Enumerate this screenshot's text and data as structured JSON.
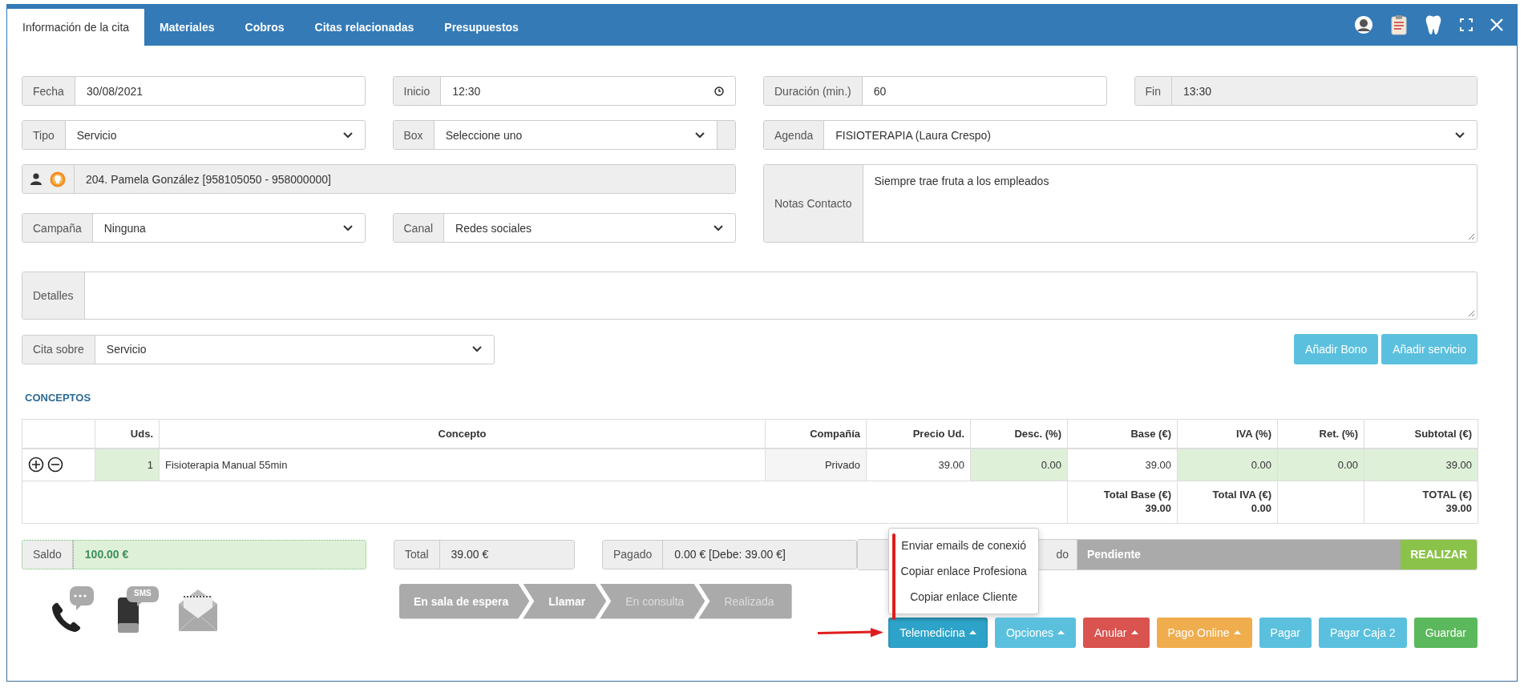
{
  "tabs": [
    {
      "label": "Información de la cita",
      "selected": true
    },
    {
      "label": "Materiales",
      "selected": false
    },
    {
      "label": "Cobros",
      "selected": false
    },
    {
      "label": "Citas relacionadas",
      "selected": false
    },
    {
      "label": "Presupuestos",
      "selected": false
    }
  ],
  "form": {
    "fecha": {
      "label": "Fecha",
      "value": "30/08/2021"
    },
    "inicio": {
      "label": "Inicio",
      "value": "12:30"
    },
    "duracion": {
      "label": "Duración (min.)",
      "value": "60"
    },
    "fin": {
      "label": "Fin",
      "value": "13:30"
    },
    "tipo": {
      "label": "Tipo",
      "value": "Servicio"
    },
    "box": {
      "label": "Box",
      "value": "Seleccione uno"
    },
    "agenda": {
      "label": "Agenda",
      "value": "FISIOTERAPIA (Laura Crespo)"
    },
    "paciente": {
      "value": "204. Pamela González [958105050 - 958000000]"
    },
    "notas_contacto": {
      "label": "Notas Contacto",
      "value": "Siempre trae fruta a los empleados"
    },
    "campana": {
      "label": "Campaña",
      "value": "Ninguna"
    },
    "canal": {
      "label": "Canal",
      "value": "Redes sociales"
    },
    "detalles": {
      "label": "Detalles"
    },
    "cita_sobre": {
      "label": "Cita sobre",
      "value": "Servicio"
    }
  },
  "add_buttons": [
    "Añadir Bono",
    "Añadir servicio"
  ],
  "section_title": "CONCEPTOS",
  "table": {
    "columns": [
      {
        "label": "Uds.",
        "kind": "editable"
      },
      {
        "label": "Concepto",
        "kind": "text"
      },
      {
        "label": "Compañía",
        "kind": "readonly"
      },
      {
        "label": "Precio Ud.",
        "kind": "plain"
      },
      {
        "label": "Desc. (%)",
        "kind": "editable"
      },
      {
        "label": "Base (€)",
        "kind": "plain"
      },
      {
        "label": "IVA (%)",
        "kind": "editable"
      },
      {
        "label": "Ret. (%)",
        "kind": "editable"
      },
      {
        "label": "Subtotal (€)",
        "kind": "editable"
      }
    ],
    "rows": [
      {
        "cells": [
          "1",
          "Fisioterapia Manual 55min",
          "Privado",
          "39.00",
          "0.00",
          "39.00",
          "0.00",
          "0.00",
          "39.00"
        ]
      }
    ],
    "totals": [
      {
        "label": "Total Base (€)",
        "value": "39.00"
      },
      {
        "label": "Total IVA (€)",
        "value": "0.00"
      },
      {
        "label": "TOTAL (€)",
        "value": "39.00"
      }
    ]
  },
  "summary": {
    "saldo": {
      "label": "Saldo",
      "value": "100.00 €"
    },
    "total": {
      "label": "Total",
      "value": "39.00 €"
    },
    "pagado": {
      "label": "Pagado",
      "value": "0.00 € [Debe: 39.00 €]"
    },
    "estado": {
      "label": "do",
      "value": "Pendiente",
      "action": "REALIZAR"
    }
  },
  "sms_icon_label": "SMS",
  "status_steps": [
    {
      "label": "En sala de espera",
      "done": true
    },
    {
      "label": "Llamar",
      "done": true
    },
    {
      "label": "En consulta",
      "done": false
    },
    {
      "label": "Realizada",
      "done": false
    }
  ],
  "action_buttons": [
    {
      "label": "Telemedicina",
      "color": "#2ea3c9",
      "caret": true,
      "expanded": true,
      "menu": [
        "Enviar emails de conexió",
        "Copiar enlace Profesiona",
        "Copiar enlace Cliente"
      ]
    },
    {
      "label": "Opciones",
      "color": "#5bc0de",
      "caret": true,
      "expanded": false
    },
    {
      "label": "Anular",
      "color": "#d9534f",
      "caret": true,
      "expanded": false
    },
    {
      "label": "Pago Online",
      "color": "#f0ad4e",
      "caret": true,
      "expanded": false
    },
    {
      "label": "Pagar",
      "color": "#5bc0de",
      "caret": false,
      "expanded": false
    },
    {
      "label": "Pagar Caja 2",
      "color": "#5bc0de",
      "caret": false,
      "expanded": false
    },
    {
      "label": "Guardar",
      "color": "#5cb85c",
      "caret": false,
      "expanded": false
    }
  ]
}
